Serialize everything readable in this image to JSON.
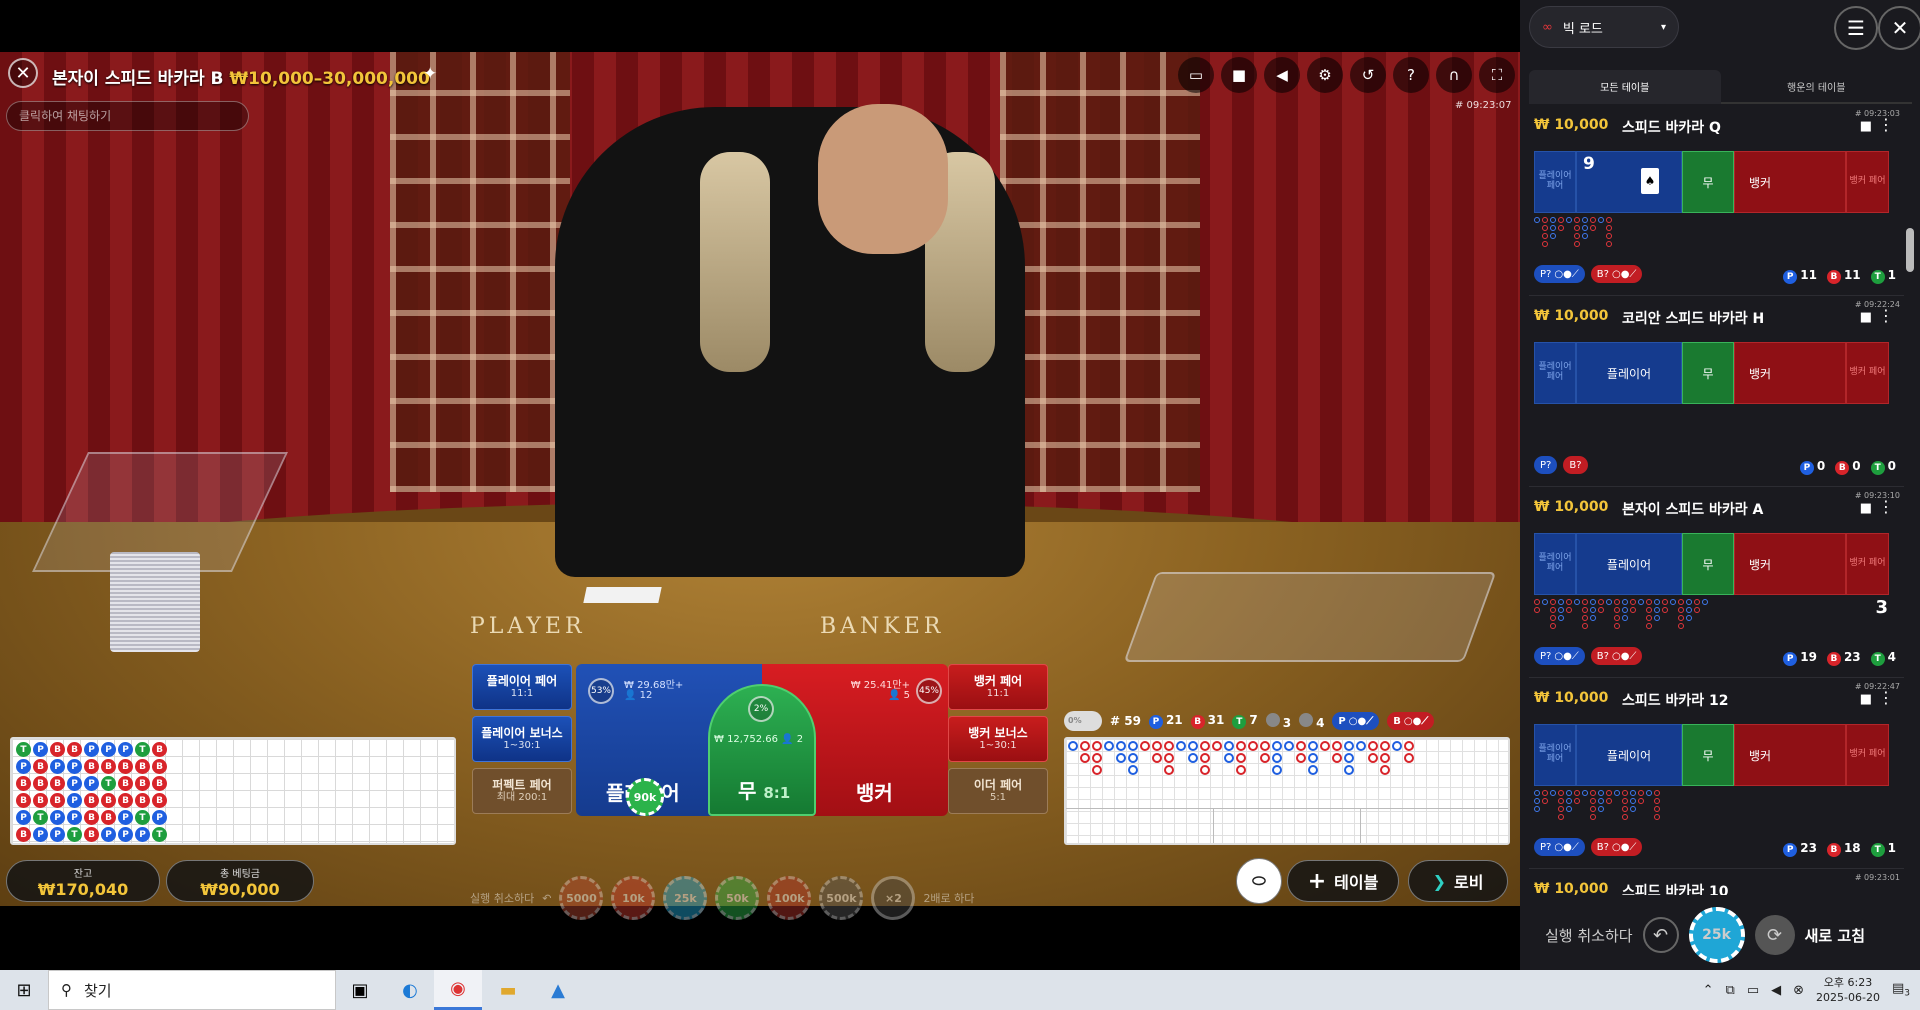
{
  "video": {
    "title": "본자이 스피드 바카라 B",
    "limit": "₩10,000–30,000,000",
    "chat_placeholder": "클릭하여 채팅하기",
    "game_id": "# 09:23:07",
    "felt_player": "PLAYER",
    "felt_banker": "BANKER",
    "toolbar_icons": [
      "chat-icon",
      "video-icon",
      "volume-icon",
      "settings-icon",
      "history-icon",
      "help-icon",
      "headset-icon",
      "fullscreen-icon"
    ]
  },
  "side_bets": {
    "player_pair": {
      "label": "플레이어 페어",
      "odds": "11:1"
    },
    "player_bonus": {
      "label": "플레이어 보너스",
      "odds": "1~30:1"
    },
    "perfect_pair": {
      "label": "퍼펙트 페어",
      "odds": "최대 200:1"
    },
    "banker_pair": {
      "label": "뱅커 페어",
      "odds": "11:1"
    },
    "banker_bonus": {
      "label": "뱅커 보너스",
      "odds": "1~30:1"
    },
    "either_pair": {
      "label": "이더 페어",
      "odds": "5:1"
    }
  },
  "main_bets": {
    "player_label": "플레이어",
    "player_total": "₩ 29.68만+",
    "player_count": "12",
    "player_pct": "53%",
    "banker_label": "뱅커",
    "banker_total": "₩ 25.41만+",
    "banker_count": "5",
    "banker_pct": "45%",
    "tie_label": "무",
    "tie_odds": "8:1",
    "tie_total": "₩ 12,752.66",
    "tie_count": "2",
    "tie_pct": "2%",
    "placed_chip": "90k"
  },
  "bead_road": [
    "T",
    "P",
    "B",
    "B",
    "P",
    "B",
    "P",
    "B",
    "B",
    "B",
    "T",
    "P",
    "B",
    "P",
    "B",
    "B",
    "P",
    "P",
    "B",
    "P",
    "P",
    "P",
    "P",
    "T",
    "P",
    "B",
    "P",
    "B",
    "B",
    "B",
    "P",
    "B",
    "T",
    "B",
    "B",
    "P",
    "P",
    "B",
    "B",
    "B",
    "P",
    "P",
    "T",
    "B",
    "B",
    "B",
    "T",
    "P",
    "B",
    "B",
    "B",
    "B",
    "P",
    "T"
  ],
  "road_stats": {
    "toggle": "0%",
    "rounds": "# 59",
    "player": "21",
    "banker": "31",
    "tie": "7",
    "player_pair": "3",
    "banker_pair": "4",
    "predict_player": "P",
    "predict_banker": "B"
  },
  "balance": {
    "balance_label": "잔고",
    "balance_value": "₩170,040",
    "bet_label": "총 베팅금",
    "bet_value": "₩90,000"
  },
  "chip_tray": {
    "undo": "실행 취소하다",
    "chips": [
      "5000",
      "10k",
      "25k",
      "50k",
      "100k",
      "500k"
    ],
    "double": "×2",
    "double_label": "2배로 하다"
  },
  "actions": {
    "add_table": "테이블",
    "lobby": "로비"
  },
  "panel": {
    "road_select": "빅 로드",
    "tab_all": "모든 테이블",
    "tab_lucky": "행운의 테이블",
    "tables": [
      {
        "id": "# 09:23:03",
        "stake": "₩ 10,000",
        "name": "스피드 바카라 Q",
        "player_pair": "플레이어 페어",
        "player": "9",
        "tie": "무",
        "banker": "뱅커",
        "banker_pair": "뱅커 페어",
        "p_count": "11",
        "b_count": "11",
        "t_count": "1",
        "pred_p": "P?",
        "pred_b": "B?"
      },
      {
        "id": "# 09:22:24",
        "stake": "₩ 10,000",
        "name": "코리안 스피드 바카라 H",
        "player_pair": "플레이어 페어",
        "player": "플레이어",
        "tie": "무",
        "banker": "뱅커",
        "banker_pair": "뱅커 페어",
        "p_count": "0",
        "b_count": "0",
        "t_count": "0",
        "pred_p": "P?",
        "pred_b": "B?"
      },
      {
        "id": "# 09:23:10",
        "stake": "₩ 10,000",
        "name": "본자이 스피드 바카라 A",
        "player_pair": "플레이어 페어",
        "player": "플레이어",
        "tie": "무",
        "banker": "뱅커",
        "banker_pair": "뱅커 페어",
        "p_count": "19",
        "b_count": "23",
        "t_count": "4",
        "pred_p": "P?",
        "pred_b": "B?",
        "timer": "3"
      },
      {
        "id": "# 09:22:47",
        "stake": "₩ 10,000",
        "name": "스피드 바카라 12",
        "player_pair": "플레이어 페어",
        "player": "플레이어",
        "tie": "무",
        "banker": "뱅커",
        "banker_pair": "뱅커 페어",
        "p_count": "23",
        "b_count": "18",
        "t_count": "1",
        "pred_p": "P?",
        "pred_b": "B?"
      },
      {
        "id": "# 09:23:01",
        "stake": "₩ 10,000",
        "name": "스피드 바카라 10"
      }
    ],
    "undo_label": "실행 취소하다",
    "chip_value": "25k",
    "refresh_label": "새로 고침"
  },
  "taskbar": {
    "search_placeholder": "찾기",
    "time": "오후 6:23",
    "date": "2025-06-20",
    "notif_count": "3"
  },
  "colors": {
    "player_blue": "#1f5fe0",
    "banker_red": "#d8242a",
    "tie_green": "#1e9e3e",
    "gold": "#f3c53a"
  }
}
